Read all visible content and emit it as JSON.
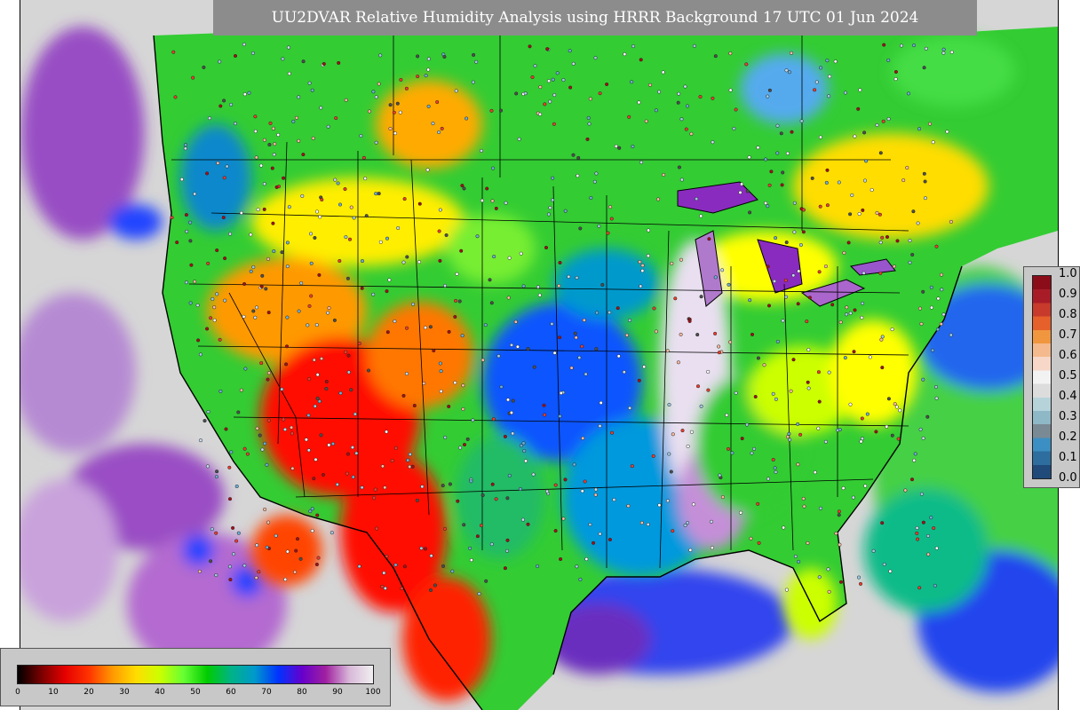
{
  "title": "UU2DVAR Relative Humidity Analysis using HRRR Background 17 UTC 01 Jun 2024",
  "right_legend": {
    "ticks": [
      "1.0",
      "0.9",
      "0.8",
      "0.7",
      "0.6",
      "0.5",
      "0.4",
      "0.3",
      "0.2",
      "0.1",
      "0.0"
    ],
    "colors": [
      "#8b0d1a",
      "#a81c28",
      "#c73a2c",
      "#e5602a",
      "#f0963f",
      "#f4b98d",
      "#f7d7c8",
      "#f2f2f2",
      "#dcdcdc",
      "#b6d3d9",
      "#8fb8c7",
      "#7a8a94",
      "#3c8fc2",
      "#2d6e9f",
      "#1f4a7a"
    ]
  },
  "bottom_legend": {
    "ticks": [
      "0",
      "10",
      "20",
      "30",
      "40",
      "50",
      "60",
      "70",
      "80",
      "90",
      "100"
    ],
    "colors": [
      "#000000",
      "#7a0000",
      "#e60000",
      "#ff3300",
      "#ff9900",
      "#ffdd00",
      "#ccff00",
      "#66ff33",
      "#00cc00",
      "#00b386",
      "#0099cc",
      "#0033ff",
      "#6600cc",
      "#a020a0",
      "#d8b8d8",
      "#f0f0f0"
    ]
  },
  "field": {
    "ocean_color": "#d0d0d0",
    "land_base_color": "#33cc33"
  }
}
